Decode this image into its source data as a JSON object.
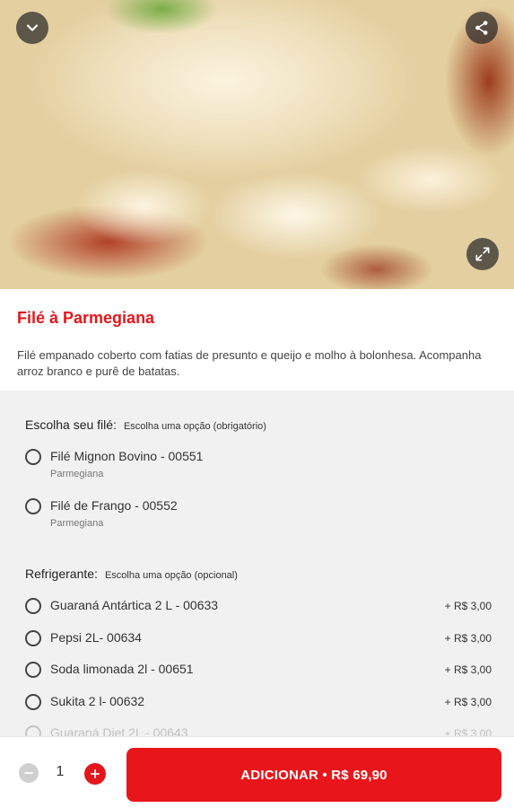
{
  "product": {
    "title": "Filé à Parmegiana",
    "description": "Filé empanado coberto com fatias de presunto e queijo e molho à bolonhesa. Acompanha arroz branco e purê de batatas."
  },
  "groups": [
    {
      "title": "Escolha seu filé:",
      "hint": "Escolha uma opção (obrigatório)",
      "options": [
        {
          "label": "Filé Mignon Bovino - 00551",
          "sub": "Parmegiana"
        },
        {
          "label": "Filé de Frango - 00552",
          "sub": "Parmegiana"
        }
      ]
    },
    {
      "title": "Refrigerante:",
      "hint": "Escolha uma opção (opcional)",
      "options": [
        {
          "label": "Guaraná Antártica 2 L - 00633",
          "price": "+ R$ 3,00"
        },
        {
          "label": "Pepsi 2L- 00634",
          "price": "+ R$ 3,00"
        },
        {
          "label": "Soda limonada 2l - 00651",
          "price": "+ R$ 3,00"
        },
        {
          "label": "Sukita 2 l- 00632",
          "price": "+ R$ 3,00"
        },
        {
          "label": "Guaraná Diet 2L - 00643",
          "price": "+ R$ 3,00"
        }
      ]
    }
  ],
  "cart": {
    "quantity": "1",
    "add_label": "ADICIONAR • R$ 69,90"
  },
  "icons": {
    "collapse": "chevron-down-icon",
    "share": "share-icon",
    "expand": "expand-icon",
    "minus": "minus-icon",
    "plus": "plus-icon"
  },
  "colors": {
    "accent": "#e4161b",
    "options_bg": "#f1f1f1"
  }
}
